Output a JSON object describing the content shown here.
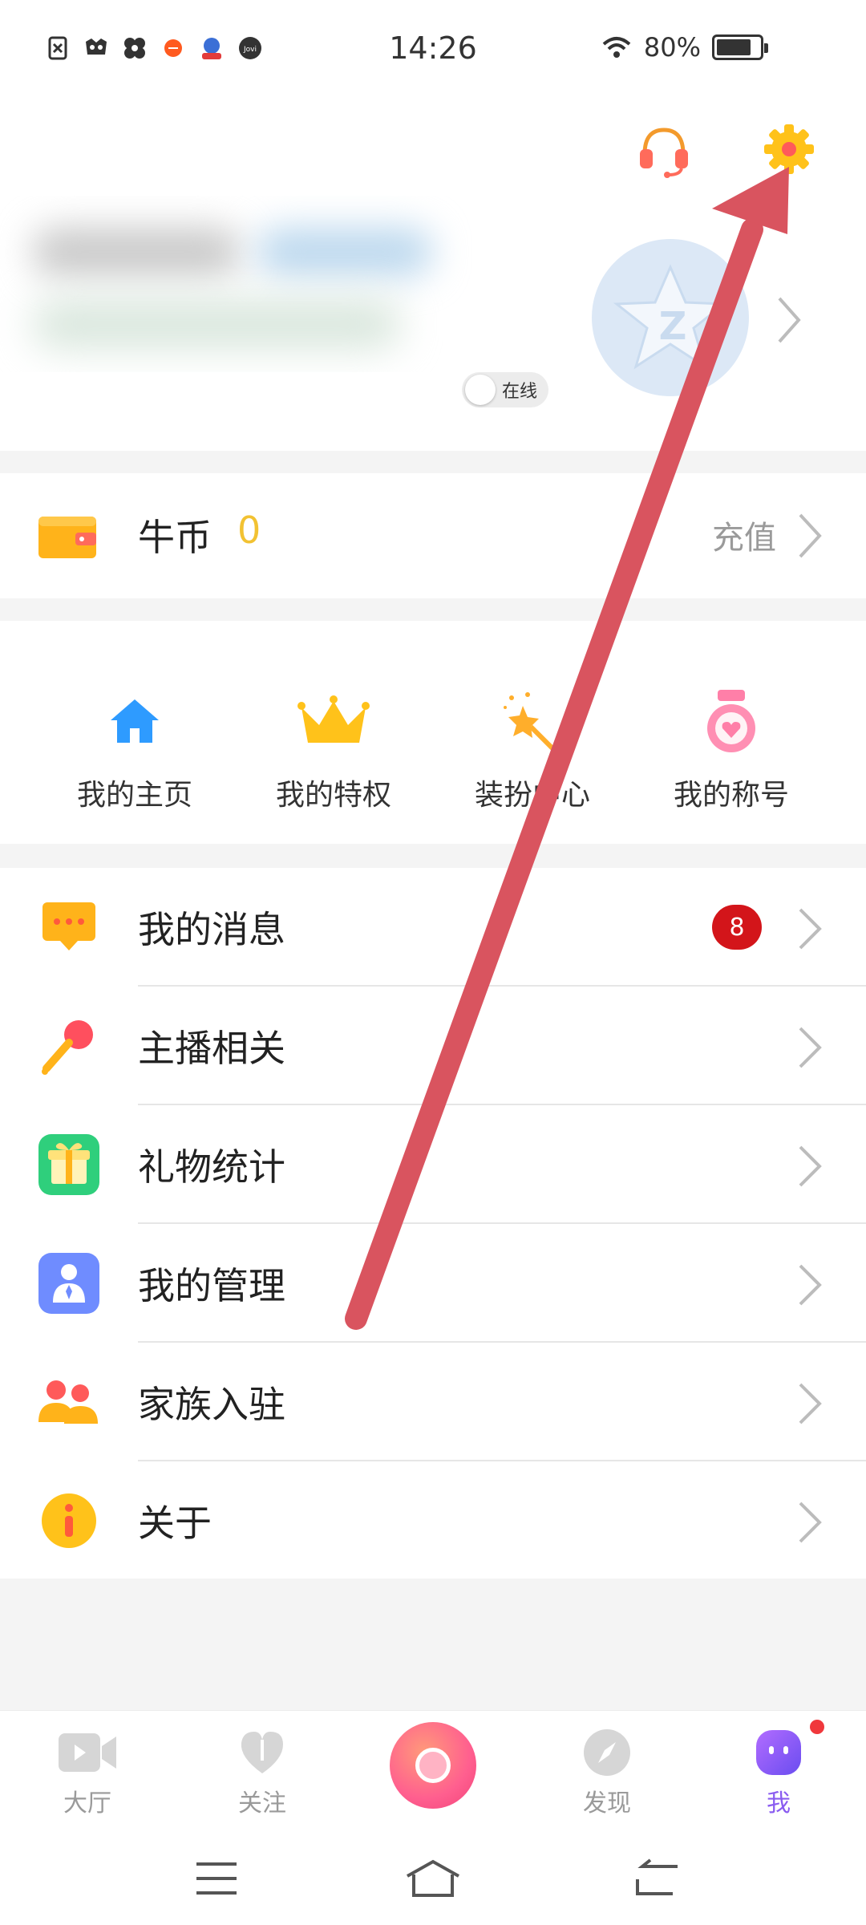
{
  "status_bar": {
    "time": "14:26",
    "battery": "80%",
    "battery_level": 0.8,
    "notification_icons": [
      "close-file-icon",
      "raccoon-icon",
      "pinwheel-icon",
      "orange-dot-icon",
      "baby-app-icon",
      "jovi-icon"
    ]
  },
  "profile": {
    "online_label": "在线",
    "header_icons": [
      "headset-icon",
      "gear-icon"
    ]
  },
  "coins": {
    "label": "牛币",
    "value": "0",
    "recharge_label": "充值"
  },
  "quick_grid": [
    {
      "label": "我的主页",
      "icon": "home-icon",
      "color": "#2e9bff"
    },
    {
      "label": "我的特权",
      "icon": "crown-icon",
      "color": "#ffc21a"
    },
    {
      "label": "装扮中心",
      "icon": "magic-wand-icon",
      "color": "#ffae2b"
    },
    {
      "label": "我的称号",
      "icon": "medal-icon",
      "color": "#ff7fa8"
    }
  ],
  "menu": [
    {
      "label": "我的消息",
      "icon": "message-icon",
      "color": "#ffb31a",
      "badge": "8"
    },
    {
      "label": "主播相关",
      "icon": "microphone-icon",
      "color": "#ff8a3d"
    },
    {
      "label": "礼物统计",
      "icon": "gift-icon",
      "color": "#2fcf7c"
    },
    {
      "label": "我的管理",
      "icon": "manager-icon",
      "color": "#6f8cff"
    },
    {
      "label": "家族入驻",
      "icon": "family-icon",
      "color": "#ffb31a"
    },
    {
      "label": "关于",
      "icon": "info-icon",
      "color": "#ffc21a"
    }
  ],
  "tabs": [
    {
      "label": "大厅",
      "icon": "video-icon"
    },
    {
      "label": "关注",
      "icon": "heart-icon"
    },
    {
      "label": "发现",
      "icon": "compass-icon"
    },
    {
      "label": "我",
      "icon": "profile-face-icon",
      "active": true
    }
  ],
  "accent_colors": {
    "coin_value": "#f2c232",
    "badge": "#d3151a",
    "active_tab": "#8a5cf0",
    "annotation_arrow": "#d9545f"
  }
}
